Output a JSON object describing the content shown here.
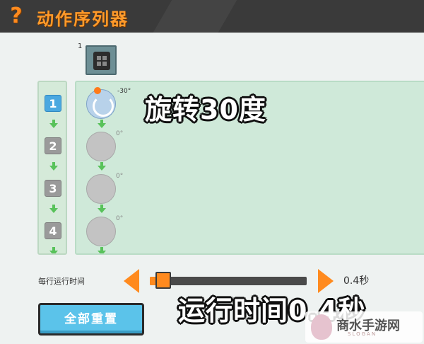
{
  "header": {
    "title": "动作序列器",
    "help_icon": "?"
  },
  "block": {
    "index": "1",
    "icon": "cube-block-icon"
  },
  "rows": [
    {
      "number": "1",
      "active": true
    },
    {
      "number": "2",
      "active": false
    },
    {
      "number": "3",
      "active": false
    },
    {
      "number": "4",
      "active": false
    }
  ],
  "actions": [
    {
      "angle": "-30°",
      "active": true
    },
    {
      "angle": "0°",
      "active": false
    },
    {
      "angle": "0°",
      "active": false
    },
    {
      "angle": "0°",
      "active": false
    }
  ],
  "overlays": {
    "rotate": "旋转30度",
    "runtime": "运行时间0.4秒"
  },
  "controls": {
    "time_label": "每行运行时间",
    "time_value": "0.4秒",
    "slider_fraction": 0.04,
    "reset_label": "全部重置"
  },
  "watermark": {
    "text": "商水手游网",
    "sub": "SLOGAN"
  },
  "colors": {
    "accent": "#ff8a1e",
    "active_blue": "#4aa8e0",
    "panel_green": "#cfe9d9",
    "header_dark": "#3a3a3a"
  }
}
